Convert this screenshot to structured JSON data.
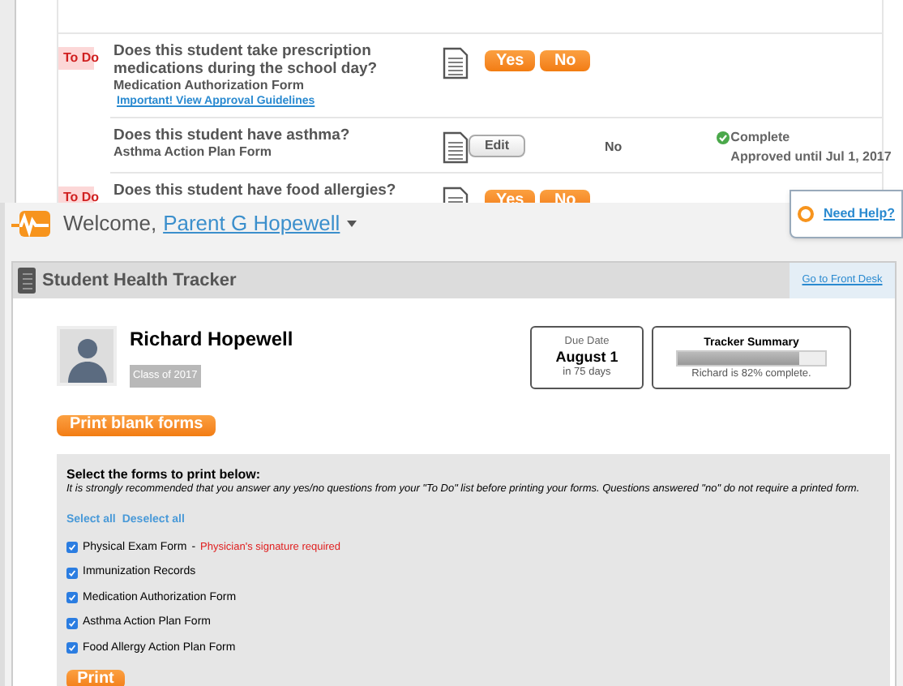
{
  "questions": [
    {
      "todo": true,
      "question": "Does this student take prescription medications during the school day?",
      "form": "Medication Authorization Form",
      "link": "Important! View Approval Guidelines",
      "todo_label": "To Do",
      "answer": {
        "kind": "choice",
        "buttons": [
          "Yes",
          "No"
        ]
      }
    },
    {
      "todo": false,
      "question": "Does this student have asthma?",
      "form": "Asthma Action Plan Form",
      "answer": {
        "kind": "edit",
        "button": "Edit",
        "value": "No",
        "status": "Complete",
        "approval": "Approved until Jul 1, 2017"
      }
    },
    {
      "todo": true,
      "question": "Does this student have food allergies?",
      "todo_label": "To Do",
      "answer": {
        "kind": "choice",
        "buttons": [
          "Yes",
          "No"
        ]
      }
    }
  ],
  "header": {
    "welcome": "Welcome,",
    "user": "Parent G Hopewell",
    "help": "Need Help?"
  },
  "tracker": {
    "title": "Student Health Tracker",
    "front_desk": "Go to Front Desk",
    "student": {
      "name": "Richard Hopewell",
      "class": "Class of 2017"
    },
    "due": {
      "label": "Due Date",
      "date": "August 1",
      "remaining": "in 75 days"
    },
    "summary": {
      "title": "Tracker Summary",
      "level": 0.82,
      "text": "Richard is 82% complete."
    },
    "print_blank": "Print blank forms",
    "forms": {
      "title": "Select the forms to print below:",
      "note": "It is strongly recommended that you answer any yes/no questions from your \"To Do\" list before printing your forms. Questions answered \"no\" do not require a printed form.",
      "select_all": "Select all",
      "deselect_all": "Deselect all",
      "items": [
        {
          "label": "Physical Exam Form",
          "checked": true,
          "separator": "-",
          "warning": "Physician's signature required"
        },
        {
          "label": "Immunization Records",
          "checked": true
        },
        {
          "label": "Medication Authorization Form",
          "checked": true
        },
        {
          "label": "Asthma Action Plan Form",
          "checked": true
        },
        {
          "label": "Food Allergy Action Plan Form",
          "checked": true
        }
      ],
      "print": "Print"
    }
  }
}
